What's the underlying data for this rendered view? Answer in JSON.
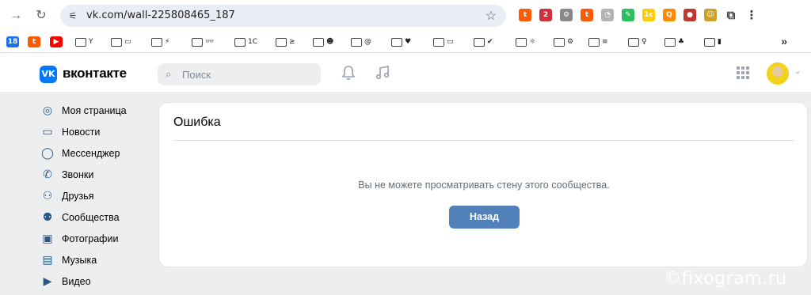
{
  "browser": {
    "url": "vk.com/wall-225808465_187",
    "back_icon": "→",
    "reload_icon": "↻",
    "star_icon": "☆",
    "extensions": [
      {
        "name": "ext-t-icon",
        "glyph": "t",
        "color": "#ff5a00"
      },
      {
        "name": "ext-abp-icon",
        "glyph": "2",
        "color": "#d0303c"
      },
      {
        "name": "ext-tool-icon",
        "glyph": "⚙",
        "color": "#888888"
      },
      {
        "name": "ext-t2-icon",
        "glyph": "t",
        "color": "#ff5a00"
      },
      {
        "name": "ext-puzzle-grey-icon",
        "glyph": "◔",
        "color": "#b0b4b8"
      },
      {
        "name": "ext-evernote-icon",
        "glyph": "✎",
        "color": "#2dbe60"
      },
      {
        "name": "ext-1c-icon",
        "glyph": "1c",
        "color": "#ffcc00"
      },
      {
        "name": "ext-orange-icon",
        "glyph": "Q",
        "color": "#ff8a00"
      },
      {
        "name": "ext-bird-icon",
        "glyph": "●",
        "color": "#c0392b"
      },
      {
        "name": "ext-face-icon",
        "glyph": "☺",
        "color": "#c9a227"
      },
      {
        "name": "extensions-puzzle-icon",
        "glyph": "⧉",
        "color": "#3c4043"
      },
      {
        "name": "menu-dots-icon",
        "glyph": "⋮",
        "color": "#3c4043"
      }
    ],
    "bookmarks": [
      {
        "name": "bookmark-calendar",
        "label": "",
        "glyph": "18"
      },
      {
        "name": "bookmark-t",
        "label": "",
        "glyph": "t"
      },
      {
        "name": "bookmark-youtube",
        "label": "",
        "glyph": "▶"
      },
      {
        "name": "bookmark-folder-y",
        "label": "Y",
        "glyph": ""
      },
      {
        "name": "bookmark-folder-screen",
        "label": "▭",
        "glyph": ""
      },
      {
        "name": "bookmark-folder-bolt",
        "label": "⚡",
        "glyph": ""
      },
      {
        "name": "bookmark-folder-glasses",
        "label": "👓",
        "glyph": ""
      },
      {
        "name": "bookmark-folder-1c",
        "label": "1C",
        "glyph": ""
      },
      {
        "name": "bookmark-folder-fox",
        "label": "≥",
        "glyph": ""
      },
      {
        "name": "bookmark-folder-face",
        "label": "☻",
        "glyph": ""
      },
      {
        "name": "bookmark-folder-at",
        "label": "@",
        "glyph": ""
      },
      {
        "name": "bookmark-folder-heart",
        "label": "♥",
        "glyph": ""
      },
      {
        "name": "bookmark-folder-keyboard",
        "label": "▭",
        "glyph": ""
      },
      {
        "name": "bookmark-folder-check",
        "label": "✔",
        "glyph": ""
      },
      {
        "name": "bookmark-folder-sun",
        "label": "☼",
        "glyph": ""
      },
      {
        "name": "bookmark-folder-gear",
        "label": "⚙",
        "glyph": ""
      },
      {
        "name": "bookmark-folder-lines",
        "label": "≡",
        "glyph": ""
      },
      {
        "name": "bookmark-folder-bulb",
        "label": "♀",
        "glyph": ""
      },
      {
        "name": "bookmark-folder-bag",
        "label": "♣",
        "glyph": ""
      },
      {
        "name": "bookmark-folder-book",
        "label": "▮",
        "glyph": ""
      }
    ],
    "bookmarks_more": "»"
  },
  "vk": {
    "logo_glyph": "VK",
    "brand": "вконтакте",
    "search_placeholder": "Поиск",
    "search_icon": "⌕",
    "bell_icon": "🔔",
    "music_icon": "♫",
    "avatar_caret": "⌄",
    "sidebar": [
      {
        "name": "sidebar-item-my-page",
        "label": "Моя страница",
        "icon": "◎"
      },
      {
        "name": "sidebar-item-news",
        "label": "Новости",
        "icon": "▭"
      },
      {
        "name": "sidebar-item-messenger",
        "label": "Мессенджер",
        "icon": "◯"
      },
      {
        "name": "sidebar-item-calls",
        "label": "Звонки",
        "icon": "✆"
      },
      {
        "name": "sidebar-item-friends",
        "label": "Друзья",
        "icon": "⚇"
      },
      {
        "name": "sidebar-item-communities",
        "label": "Сообщества",
        "icon": "⚉"
      },
      {
        "name": "sidebar-item-photos",
        "label": "Фотографии",
        "icon": "▣"
      },
      {
        "name": "sidebar-item-music",
        "label": "Музыка",
        "icon": "▤"
      },
      {
        "name": "sidebar-item-video",
        "label": "Видео",
        "icon": "▶"
      }
    ],
    "error": {
      "title": "Ошибка",
      "message": "Вы не можете просматривать стену этого сообщества.",
      "back_button": "Назад"
    }
  },
  "watermark": "©fixogram.ru",
  "colors": {
    "vk_blue": "#0077ff",
    "button_blue": "#5181b8",
    "page_bg": "#edeef0"
  }
}
